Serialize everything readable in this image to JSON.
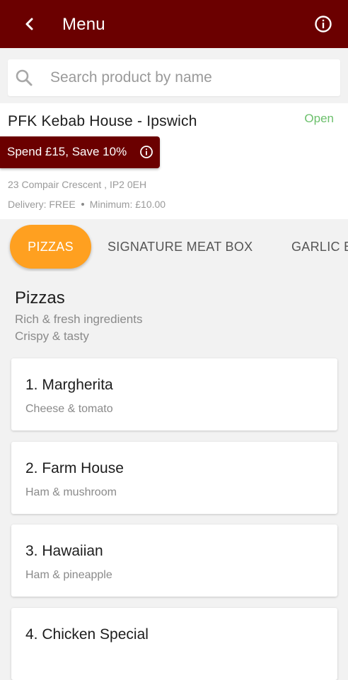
{
  "appbar": {
    "title": "Menu",
    "back_icon": "chevron-left-icon",
    "info_icon": "info-circle-icon",
    "background": "#6b0000"
  },
  "search": {
    "placeholder": "Search product by name",
    "value": "",
    "icon": "search-icon"
  },
  "store": {
    "name": "PFK Kebab House - Ipswich",
    "status": "Open",
    "status_color": "#6cc06c",
    "promo": "Spend £15, Save 10%",
    "address": "23 Compair Crescent , IP2 0EH",
    "delivery": "Delivery: FREE",
    "minimum": "Minimum: £10.00"
  },
  "categories": [
    {
      "label": "PIZZAS",
      "active": true
    },
    {
      "label": "SIGNATURE MEAT BOX",
      "active": false
    },
    {
      "label": "GARLIC B",
      "active": false
    }
  ],
  "section": {
    "title": "Pizzas",
    "desc1": "Rich & fresh ingredients",
    "desc2": "Crispy & tasty"
  },
  "products": [
    {
      "name": "1. Margherita",
      "desc": "Cheese & tomato"
    },
    {
      "name": "2. Farm House",
      "desc": "Ham & mushroom"
    },
    {
      "name": "3. Hawaiian",
      "desc": "Ham & pineapple"
    },
    {
      "name": "4. Chicken Special",
      "desc": ""
    }
  ],
  "colors": {
    "brand": "#6b0000",
    "accent": "#ffa020"
  }
}
